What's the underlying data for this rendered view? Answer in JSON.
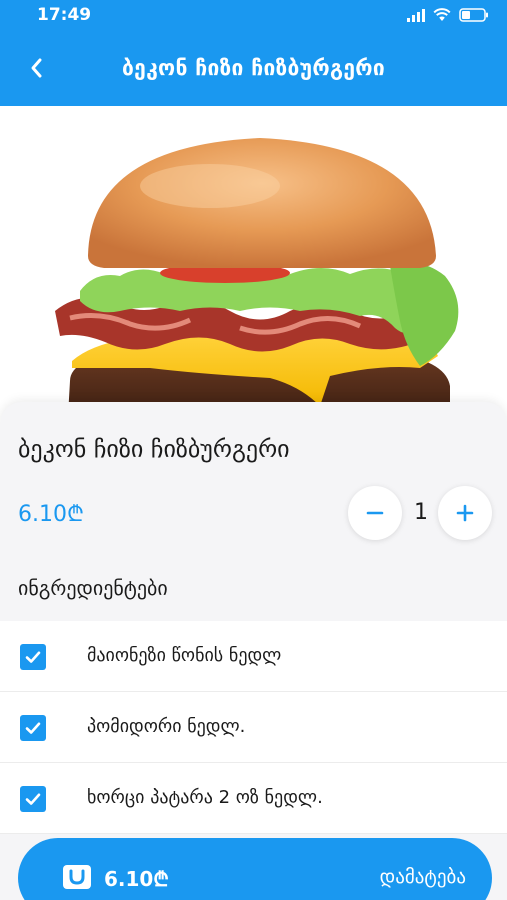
{
  "status_bar": {
    "time": "17:49",
    "icons": [
      "signal-icon",
      "wifi-icon",
      "battery-icon"
    ]
  },
  "nav": {
    "title": "ბეკონ ჩიზი ჩიზბურგერი",
    "back_icon": "chevron-left-icon"
  },
  "product": {
    "name": "ბეკონ ჩიზი ჩიზბურგერი",
    "price": "6.10₾",
    "quantity": "1"
  },
  "ingredients": {
    "title": "ინგრედიენტები",
    "items": [
      {
        "label": "მაიონეზი წონის ნედლ",
        "checked": true
      },
      {
        "label": "პომიდორი ნედლ.",
        "checked": true
      },
      {
        "label": "ხორცი პატარა 2 ოზ ნედლ.",
        "checked": true
      }
    ]
  },
  "add_bar": {
    "price": "6.10₾",
    "label": "დამატება"
  },
  "colors": {
    "accent": "#1a98f0",
    "background": "#f5f5f7"
  }
}
